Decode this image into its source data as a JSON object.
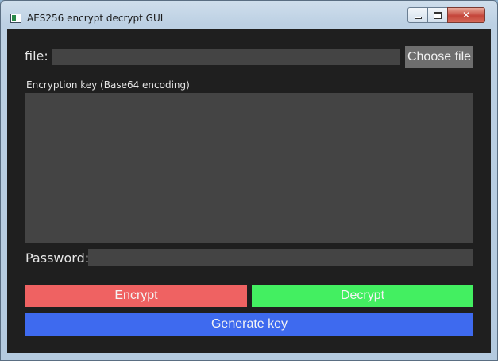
{
  "window": {
    "title": "AES256 encrypt decrypt GUI",
    "close_glyph": "✕"
  },
  "file": {
    "label": "file:",
    "value": "",
    "choose_button": "Choose file"
  },
  "key": {
    "label": "Encryption key (Base64 encoding)",
    "value": ""
  },
  "password": {
    "label": "Password:",
    "value": ""
  },
  "actions": {
    "encrypt": "Encrypt",
    "decrypt": "Decrypt",
    "generate_key": "Generate key"
  },
  "colors": {
    "encrypt": "#ef6262",
    "decrypt": "#43ef61",
    "generate_key": "#3e6aef",
    "background": "#1f1f1f",
    "field": "#444444"
  }
}
